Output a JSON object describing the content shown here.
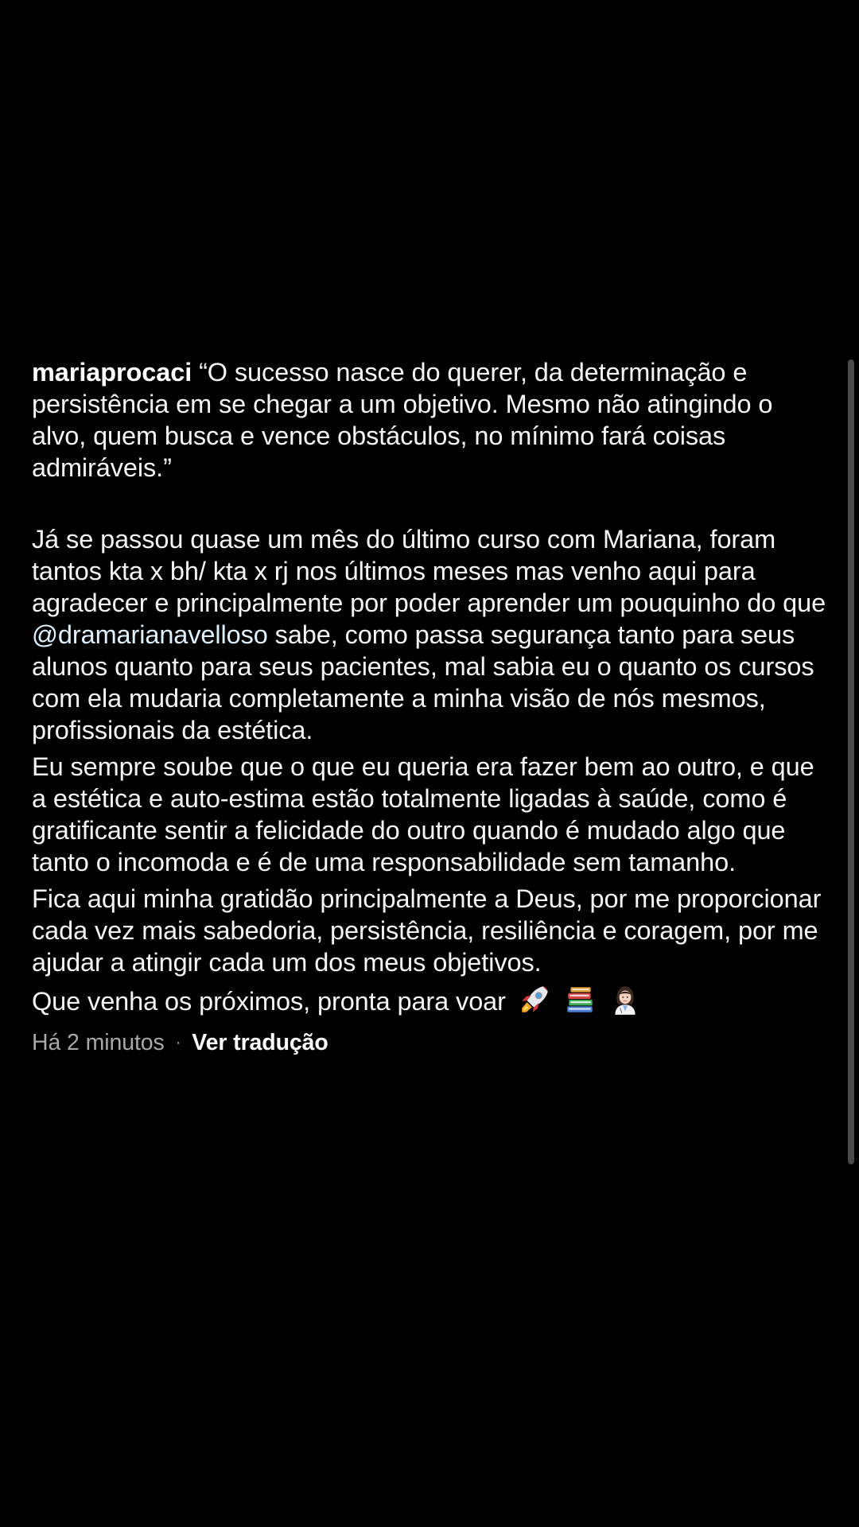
{
  "post": {
    "username": "mariaprocaci",
    "quote": "“O sucesso nasce do querer, da determinação e persistência em se chegar a um objetivo. Mesmo não atingindo o alvo, quem busca e vence obstáculos, no mínimo fará coisas admiráveis.”",
    "paragraph2_before_mention": "Já se passou quase um mês do último curso com Mariana, foram tantos kta x bh/ kta x rj nos últimos meses mas venho aqui para agradecer e principalmente por poder aprender um pouquinho do que ",
    "mention": "@dramarianavelloso",
    "paragraph2_after_mention": " sabe, como passa segurança tanto para seus alunos quanto para seus pacientes, mal sabia eu o quanto os cursos com ela mudaria completamente a minha visão de nós mesmos, profissionais da estética.",
    "paragraph3": "Eu sempre soube que o que eu queria era fazer bem ao outro, e que a estética e auto-estima estão totalmente ligadas à saúde, como é gratificante sentir a felicidade do outro quando é mudado algo que tanto o incomoda e é de uma responsabilidade sem tamanho.",
    "paragraph4": "Fica aqui minha gratidão principalmente a Deus, por me proporcionar cada vez mais sabedoria, persistência, resiliência e coragem, por me ajudar a atingir cada um dos meus objetivos.",
    "paragraph5": "Que venha os próximos, pronta para voar",
    "emojis": [
      "rocket-icon",
      "books-icon",
      "woman-health-worker-icon"
    ],
    "timestamp": "Há 2 minutos",
    "separator": "·",
    "translate_label": "Ver tradução"
  },
  "colors": {
    "background": "#000000",
    "text": "#f5f5f5",
    "muted": "#a8a8a8",
    "mention": "#e0f1ff",
    "scrollbar": "#4a4a4a"
  }
}
